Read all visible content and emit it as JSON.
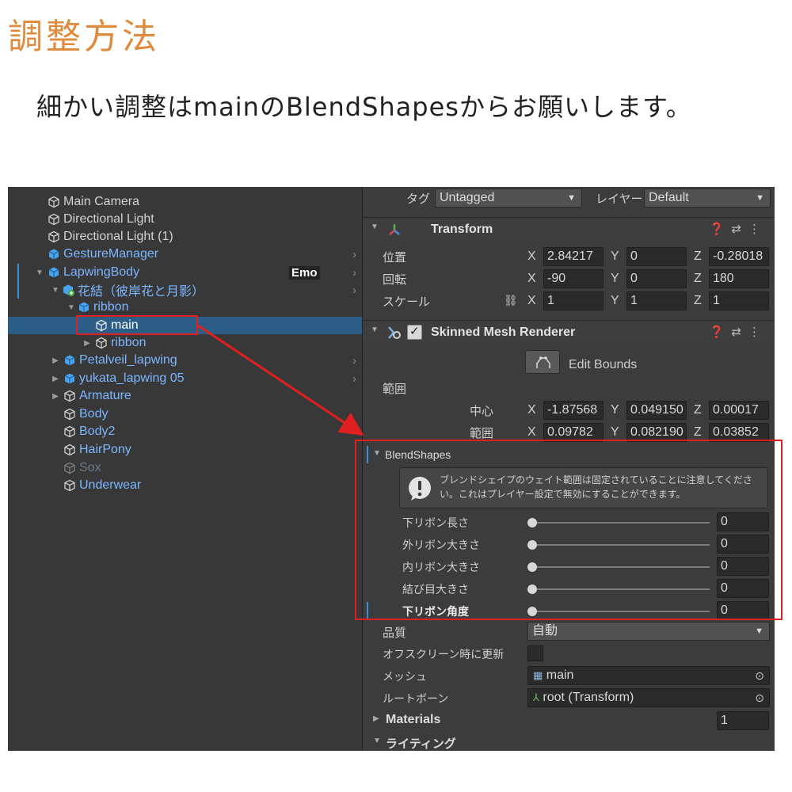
{
  "page": {
    "title": "調整方法",
    "subtitle": "細かい調整はmainのBlendShapesからお願いします。"
  },
  "hierarchy": {
    "items": [
      {
        "label": "Main Camera",
        "kind": "object"
      },
      {
        "label": "Directional Light",
        "kind": "object"
      },
      {
        "label": "Directional Light (1)",
        "kind": "object"
      },
      {
        "label": "GestureManager",
        "kind": "prefab"
      },
      {
        "label": "LapwingBody",
        "kind": "prefab",
        "tag": "Emo"
      },
      {
        "label": "花結（彼岸花と月影）",
        "kind": "prefab"
      },
      {
        "label": "ribbon",
        "kind": "prefab"
      },
      {
        "label": "main",
        "kind": "object",
        "selected": true
      },
      {
        "label": "ribbon",
        "kind": "object"
      },
      {
        "label": "Petalveil_lapwing",
        "kind": "prefab"
      },
      {
        "label": "yukata_lapwing 05",
        "kind": "prefab"
      },
      {
        "label": "Armature",
        "kind": "prefab"
      },
      {
        "label": "Body",
        "kind": "prefab"
      },
      {
        "label": "Body2",
        "kind": "prefab"
      },
      {
        "label": "HairPony",
        "kind": "prefab"
      },
      {
        "label": "Sox",
        "kind": "disabled"
      },
      {
        "label": "Underwear",
        "kind": "prefab"
      }
    ]
  },
  "inspector": {
    "tag_label": "タグ",
    "tag_value": "Untagged",
    "layer_label": "レイヤー",
    "layer_value": "Default",
    "transform": {
      "title": "Transform",
      "position_label": "位置",
      "rotation_label": "回転",
      "scale_label": "スケール",
      "position": {
        "x": "2.84217",
        "y": "0",
        "z": "-0.28018"
      },
      "rotation": {
        "x": "-90",
        "y": "0",
        "z": "180"
      },
      "scale": {
        "x": "1",
        "y": "1",
        "z": "1"
      }
    },
    "smr": {
      "title": "Skinned Mesh Renderer",
      "edit_bounds": "Edit Bounds",
      "bounds_label": "範囲",
      "center_label": "中心",
      "extent_label": "範囲",
      "center": {
        "x": "-1.87568",
        "y": "0.049150",
        "z": "0.00017"
      },
      "extent": {
        "x": "0.09782",
        "y": "0.082190",
        "z": "0.03852"
      },
      "blendshapes_label": "BlendShapes",
      "warning": "ブレンドシェイプのウェイト範囲は固定されていることに注意してください。これはプレイヤー設定で無効にすることができます。",
      "blendshapes": [
        {
          "name": "下リボン長さ",
          "value": "0"
        },
        {
          "name": "外リボン大きさ",
          "value": "0"
        },
        {
          "name": "内リボン大きさ",
          "value": "0"
        },
        {
          "name": "結び目大きさ",
          "value": "0"
        },
        {
          "name": "下リボン角度",
          "value": "0"
        }
      ],
      "quality_label": "品質",
      "quality_value": "自動",
      "offscreen_label": "オフスクリーン時に更新",
      "mesh_label": "メッシュ",
      "mesh_value": "main",
      "rootbone_label": "ルートボーン",
      "rootbone_value": "root (Transform)",
      "materials_label": "Materials",
      "materials_value": "1",
      "lighting_label": "ライティング"
    }
  },
  "colors": {
    "title_orange": "#e08a3c",
    "highlight_red": "#e02020",
    "selection_blue": "#2c5d87",
    "prefab_blue": "#7cb6ff"
  }
}
